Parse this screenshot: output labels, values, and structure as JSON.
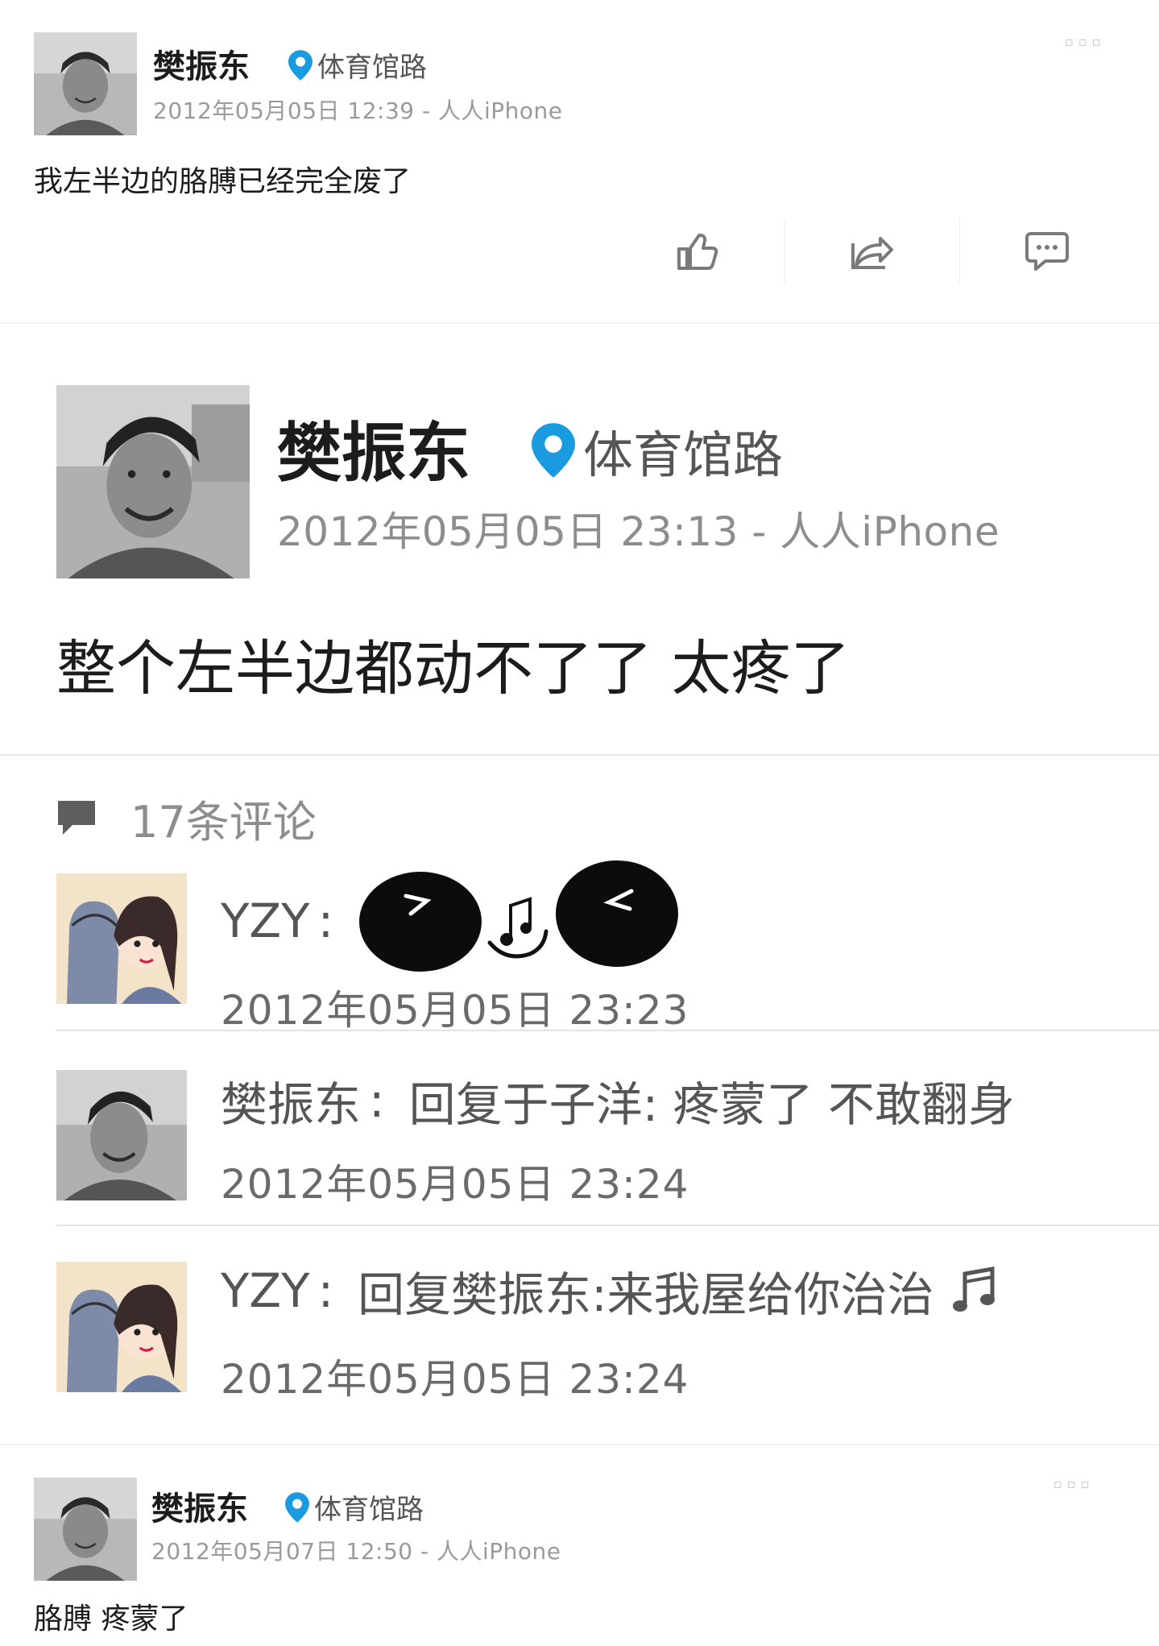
{
  "post1": {
    "author": "樊振东",
    "location": "体育馆路",
    "meta": "2012年05月05日 12:39 - 人人iPhone",
    "text": "我左半边的胳膊已经完全废了",
    "actions": [
      {
        "icon": "thumbs-up-icon"
      },
      {
        "icon": "share-icon"
      },
      {
        "icon": "comment-icon"
      }
    ]
  },
  "post2": {
    "author": "樊振东",
    "location": "体育馆路",
    "meta": "2012年05月05日 23:13 - 人人iPhone",
    "text": "整个左半边都动不了了 太疼了",
    "comments_count_label": "17条评论",
    "comments": [
      {
        "author": "YZY",
        "sep": ":",
        "body": "",
        "time": "2012年05月05日 23:23"
      },
      {
        "author": "樊振东",
        "sep": ":",
        "body": "回复于子洋: 疼蒙了 不敢翻身",
        "time": "2012年05月05日 23:24"
      },
      {
        "author": "YZY",
        "sep": ":",
        "body": "回复樊振东:来我屋给你治治",
        "time": "2012年05月05日 23:24"
      }
    ]
  },
  "post3": {
    "author": "樊振东",
    "location": "体育馆路",
    "meta": "2012年05月07日 12:50 - 人人iPhone",
    "text": "胳膊 疼蒙了"
  },
  "colors": {
    "location_pin": "#1a9be0",
    "meta_gray": "#9a9a9a",
    "divider": "#e3e3e3"
  }
}
